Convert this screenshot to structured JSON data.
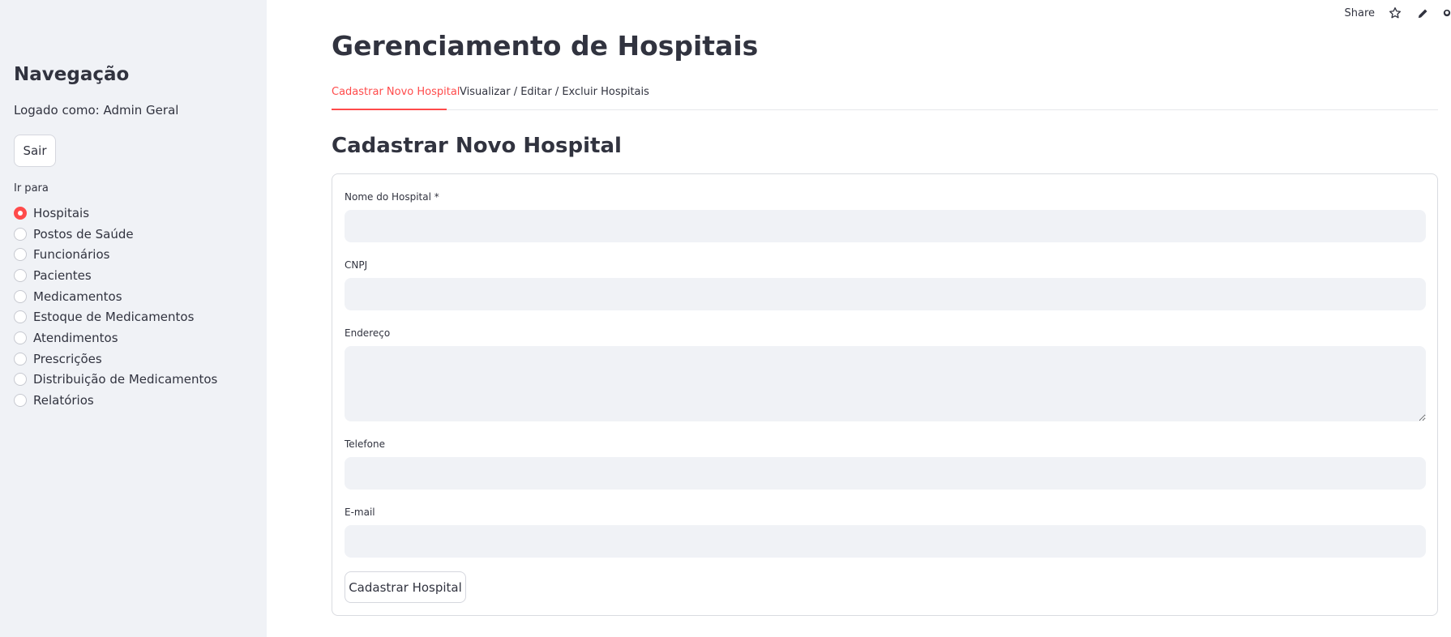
{
  "sidebar": {
    "title": "Navegação",
    "logged_in": "Logado como: Admin Geral",
    "logout_label": "Sair",
    "goto_label": "Ir para",
    "items": [
      {
        "label": "Hospitais",
        "selected": true
      },
      {
        "label": "Postos de Saúde",
        "selected": false
      },
      {
        "label": "Funcionários",
        "selected": false
      },
      {
        "label": "Pacientes",
        "selected": false
      },
      {
        "label": "Medicamentos",
        "selected": false
      },
      {
        "label": "Estoque de Medicamentos",
        "selected": false
      },
      {
        "label": "Atendimentos",
        "selected": false
      },
      {
        "label": "Prescrições",
        "selected": false
      },
      {
        "label": "Distribuição de Medicamentos",
        "selected": false
      },
      {
        "label": "Relatórios",
        "selected": false
      }
    ]
  },
  "toolbar": {
    "share_label": "Share",
    "icons": [
      "star-icon",
      "pencil-icon",
      "github-icon"
    ]
  },
  "main": {
    "title": "Gerenciamento de Hospitais",
    "tabs": [
      {
        "label": "Cadastrar Novo Hospital",
        "active": true
      },
      {
        "label": "Visualizar / Editar / Excluir Hospitais",
        "active": false
      }
    ],
    "section_title": "Cadastrar Novo Hospital",
    "form": {
      "fields": [
        {
          "label": "Nome do Hospital *",
          "value": "",
          "type": "text"
        },
        {
          "label": "CNPJ",
          "value": "",
          "type": "text"
        },
        {
          "label": "Endereço",
          "value": "",
          "type": "textarea"
        },
        {
          "label": "Telefone",
          "value": "",
          "type": "text"
        },
        {
          "label": "E-mail",
          "value": "",
          "type": "text"
        }
      ],
      "submit_label": "Cadastrar Hospital"
    }
  },
  "colors": {
    "accent": "#ff4b4b",
    "sidebar_bg": "#f0f2f6",
    "input_bg": "#f0f2f6",
    "text": "#31333f"
  }
}
